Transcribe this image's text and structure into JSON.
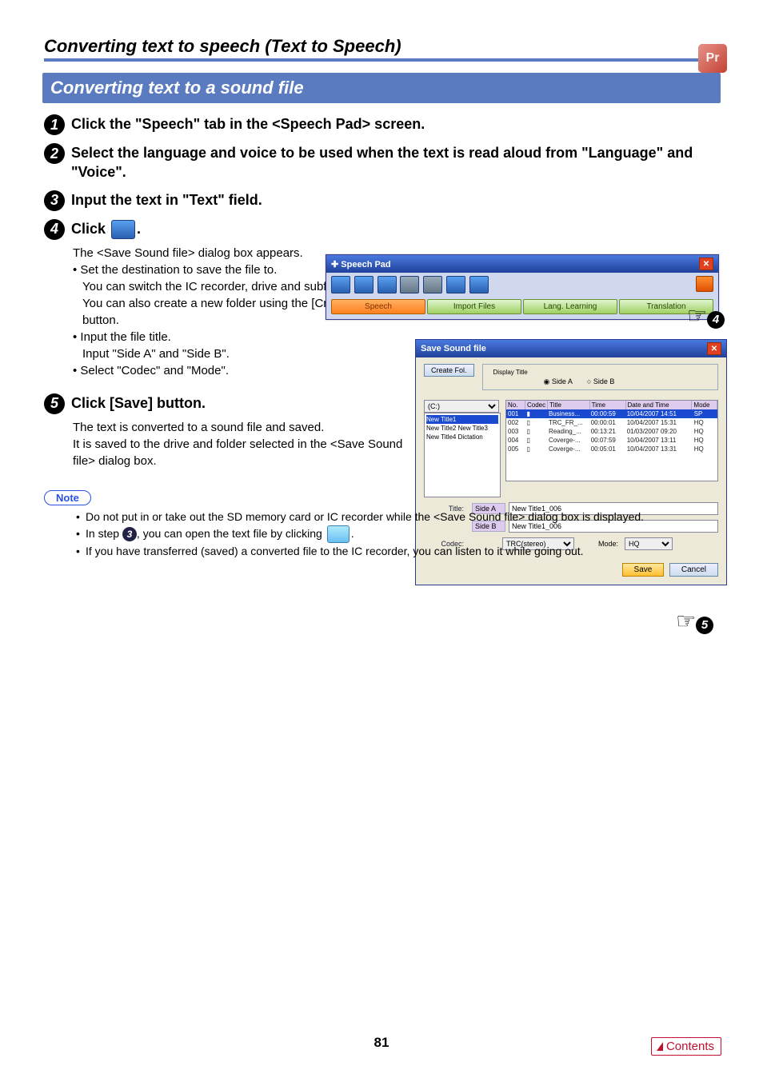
{
  "header": {
    "section_title": "Converting text to speech (Text to Speech)",
    "sub_title": "Converting text to a sound file",
    "corner_badge": "Pr"
  },
  "steps": {
    "s1": "Click the \"Speech\" tab in the <Speech Pad> screen.",
    "s2": "Select the language and voice to be used when the text is read aloud from \"Language\" and \"Voice\".",
    "s3": "Input the text in \"Text\" field.",
    "s4_prefix": "Click ",
    "s4_suffix": ".",
    "s4_body": "The <Save Sound file> dialog box appears.",
    "s4_b1_a": "Set the destination to save the file to.",
    "s4_b1_b": "You can switch the IC recorder, drive and subfolder.",
    "s4_b1_c": "You can also create a new folder using the [Create Fol.] button.",
    "s4_b2_a": "Input the file title.",
    "s4_b2_b": "Input \"Side A\" and \"Side B\".",
    "s4_b3": "Select \"Codec\" and \"Mode\".",
    "s5_title": "Click [Save] button.",
    "s5_body1": "The text is converted to a sound file and saved.",
    "s5_body2": "It is saved to the drive and folder selected in the <Save Sound file> dialog box."
  },
  "note": {
    "label": "Note",
    "n1": "Do not put in or take out the SD memory card or IC recorder while the <Save Sound file> dialog box is displayed.",
    "n2_a": "In step ",
    "n2_b": ", you can open the text file by clicking ",
    "n2_c": ".",
    "n3": "If you have transferred (saved) a converted file to the IC recorder, you can listen to it while going out."
  },
  "speech_pad": {
    "title": "Speech Pad",
    "tabs": [
      "Speech",
      "Import Files",
      "Lang. Learning",
      "Translation"
    ]
  },
  "dialog": {
    "title": "Save Sound file",
    "create_fol": "Create Fol.",
    "display_title": "Display Title",
    "side_a": "Side A",
    "side_b": "Side B",
    "drive": "(C:)",
    "tree": [
      "New Title1",
      "New Title2",
      "New Title3",
      "New Title4",
      "Dictation"
    ],
    "headers": {
      "no": "No.",
      "codec": "Codec",
      "title": "Title",
      "time": "Time",
      "date": "Date and Time",
      "mode": "Mode"
    },
    "rows": [
      {
        "no": "001",
        "title": "Business...",
        "time": "00:00:59",
        "date": "10/04/2007 14:51",
        "mode": "SP"
      },
      {
        "no": "002",
        "title": "TRC_FR_...",
        "time": "00:00:01",
        "date": "10/04/2007 15:31",
        "mode": "HQ"
      },
      {
        "no": "003",
        "title": "Reading_...",
        "time": "00:13:21",
        "date": "01/03/2007 09:20",
        "mode": "HQ"
      },
      {
        "no": "004",
        "title": "Coverge-...",
        "time": "00:07:59",
        "date": "10/04/2007 13:11",
        "mode": "HQ"
      },
      {
        "no": "005",
        "title": "Coverge-...",
        "time": "00:05:01",
        "date": "10/04/2007 13:31",
        "mode": "HQ"
      }
    ],
    "title_label": "Title:",
    "side_a_val": "New Title1_006",
    "side_b_val": "New Title1_006",
    "codec_label": "Codec:",
    "codec_val": "TRC(stereo)",
    "mode_label": "Mode:",
    "mode_val": "HQ",
    "save": "Save",
    "cancel": "Cancel"
  },
  "footer": {
    "page": "81",
    "contents": "Contents"
  }
}
